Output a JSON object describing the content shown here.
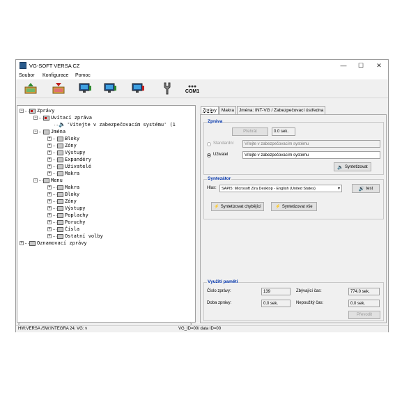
{
  "window": {
    "title": "VG-SOFT VERSA CZ",
    "minimize": "—",
    "maximize": "☐",
    "close": "✕"
  },
  "menubar": [
    "Soubor",
    "Konfigurace",
    "Pomoc"
  ],
  "toolbar": {
    "com_label": "COM1"
  },
  "tree": {
    "root1": "Zprávy",
    "uvitaci": "Uvítací zpráva",
    "vitejte": "'Vítejte v zabezpečovacím systému'  (1",
    "jmena": "Jména",
    "jmena_items": [
      "Bloky",
      "Zóny",
      "Výstupy",
      "Expandéry",
      "Uživatelé",
      "Makra"
    ],
    "menu": "Menu",
    "menu_items": [
      "Makra",
      "Bloky",
      "Zóny",
      "Výstupy",
      "Poplachy",
      "Poruchy",
      "Čísla",
      "Ostatní volby"
    ],
    "root2": "Oznamovací zprávy"
  },
  "tabs": [
    "Zprávy",
    "Makra",
    "Jména: INT-VG / Zabezpečovací ústředna"
  ],
  "zprava": {
    "group_label": "Zpráva",
    "prehrat": "Přehrát",
    "duration": "0.0 sek.",
    "standardni_label": "Standardní",
    "standardni_value": "Vítejte v zabezpečovacím systému",
    "uzivatel_label": "Uživatel",
    "uzivatel_value": "Vítejte v zabezpečovacím systému",
    "syntetizovat": "Syntetizovat"
  },
  "syntezator": {
    "group_label": "Syntezátor",
    "hlas_label": "Hlas:",
    "hlas_value": "SAPI5: Microsoft Zira Desktop - English (United States)",
    "test": "test",
    "syntetizovat_chybejici": "Syntetizovat chybějící",
    "syntetizovat_vse": "Syntetizovat vše"
  },
  "pamet": {
    "group_label": "Využití paměti",
    "cislo_zpravy_label": "Číslo zprávy:",
    "cislo_zpravy": "139",
    "zbyvajici_label": "Zbývající čas:",
    "zbyvajici": "774.0 sek.",
    "doba_zpravy_label": "Doba zprávy:",
    "doba_zpravy": "0.0 sek.",
    "nepouzity_label": "Nepoužitý čas:",
    "nepouzity": "0.0 sek.",
    "prevodit": "Převodit"
  },
  "statusbar": {
    "left": "HW:VERSA /SW:INTEGRA 24; VG: v",
    "right": "VG_ID=00/ data ID=00"
  }
}
